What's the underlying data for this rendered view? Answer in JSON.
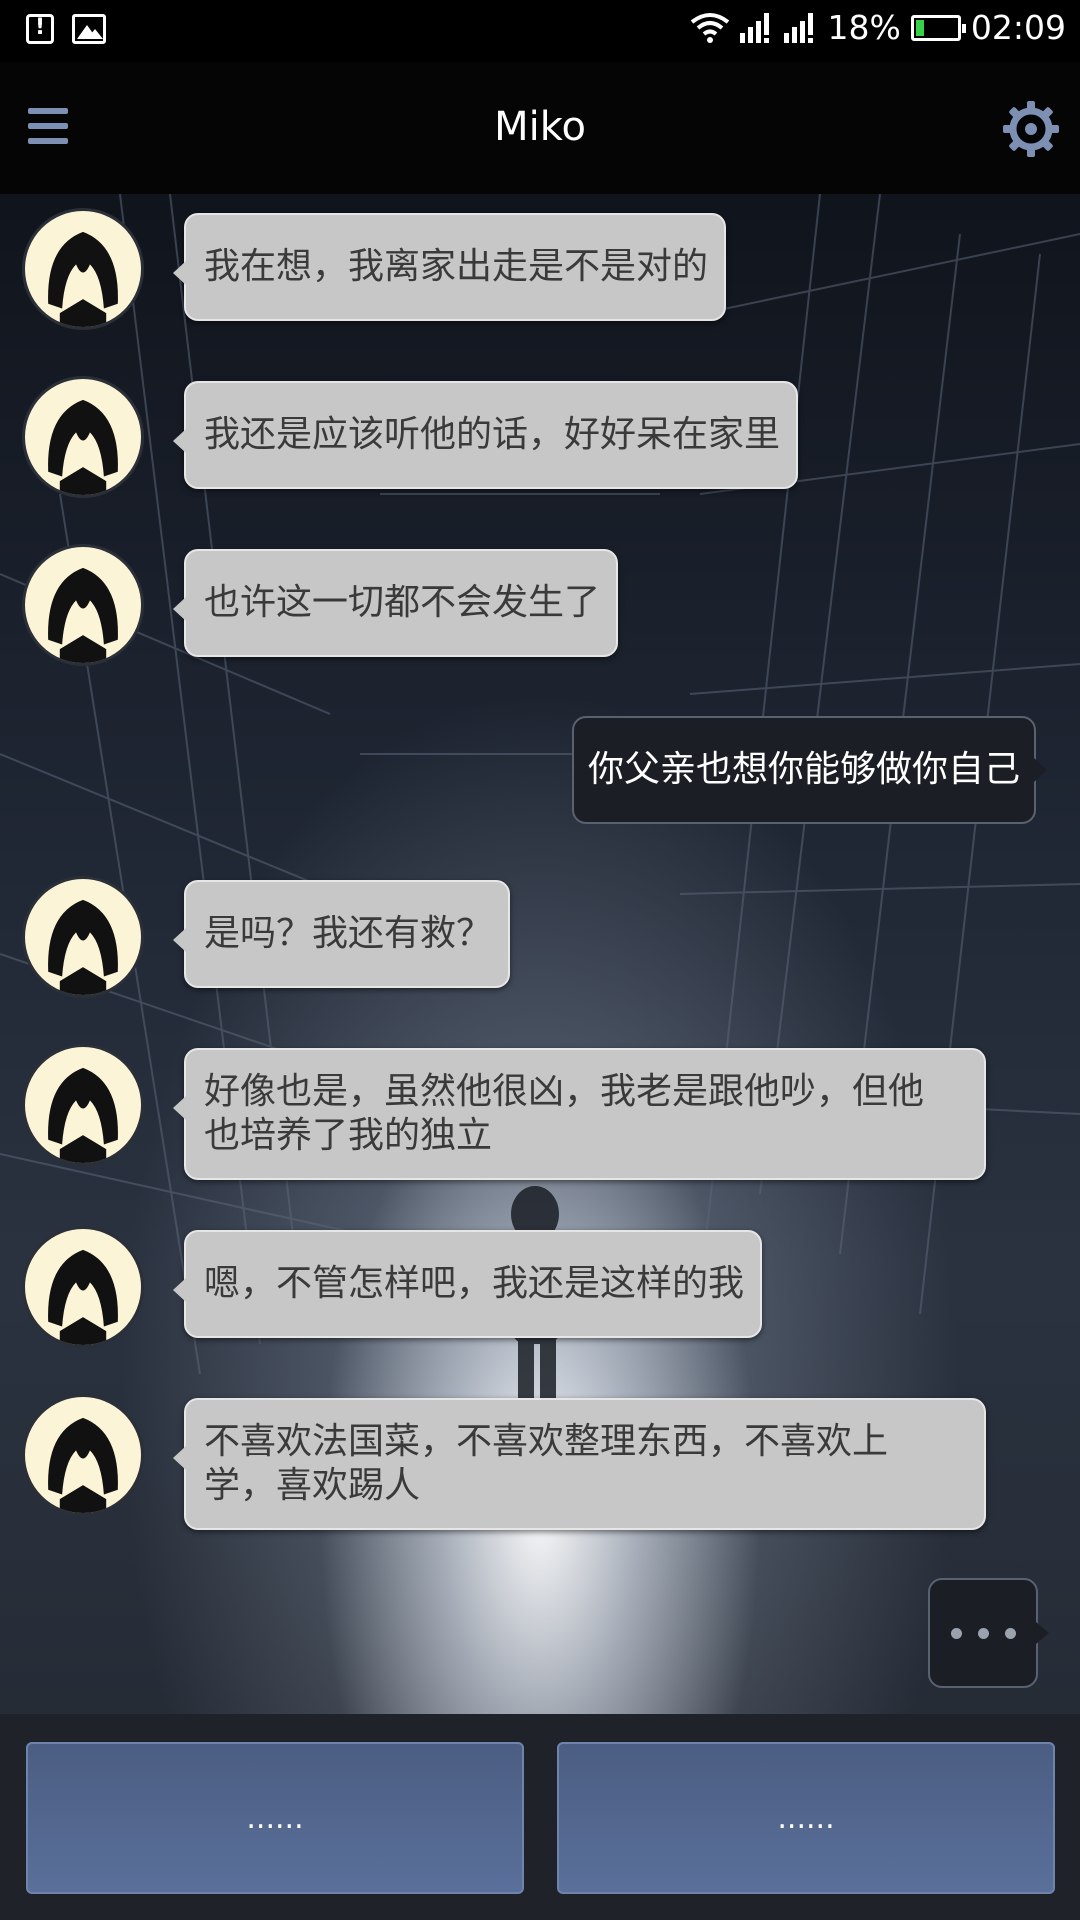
{
  "status_bar": {
    "battery": "18%",
    "battery_level": 0.18,
    "time": "02:09",
    "left_icons": [
      "alert-icon",
      "image-icon"
    ],
    "right_icons": [
      "wifi-icon",
      "signal-icon",
      "signal-icon"
    ]
  },
  "app_bar": {
    "title": "Miko",
    "left_icon": "menu-icon",
    "right_icon": "gear-icon",
    "icon_color": "#7d8fb3"
  },
  "messages": [
    {
      "from": "Miko",
      "text": "我在想，我离家出走是不是对的"
    },
    {
      "from": "Miko",
      "text": "我还是应该听他的话，好好呆在家里"
    },
    {
      "from": "Miko",
      "text": "也许这一切都不会发生了"
    },
    {
      "from": "me",
      "text": "你父亲也想你能够做你自己"
    },
    {
      "from": "Miko",
      "text": "是吗？我还有救？"
    },
    {
      "from": "Miko",
      "text_line1": "好像也是，虽然他很凶，我老是跟他吵，但他",
      "text_line2": "也培养了我的独立"
    },
    {
      "from": "Miko",
      "text": "嗯，不管怎样吧，我还是这样的我"
    },
    {
      "from": "Miko",
      "text_line1": "不喜欢法国菜，不喜欢整理东西，不喜欢上",
      "text_line2": "学，喜欢踢人"
    }
  ],
  "reply_options": [
    {
      "label": "......"
    },
    {
      "label": "......"
    }
  ],
  "colors": {
    "npc_bubble": "#c7c7c7",
    "user_bubble": "#1b1e25",
    "reply_button": "#51658c",
    "battery_fill": "#35d24a"
  }
}
